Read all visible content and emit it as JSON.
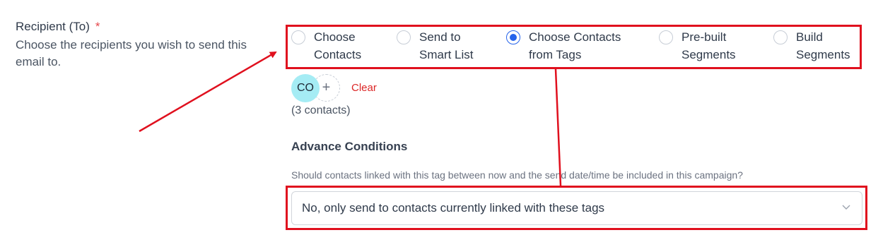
{
  "recipient": {
    "label": "Recipient (To)",
    "required_mark": "*",
    "help_text": "Choose the recipients you wish to send this email to."
  },
  "radio_options": [
    {
      "line1": "Choose",
      "line2": "Contacts",
      "selected": false
    },
    {
      "line1": "Send to",
      "line2": "Smart List",
      "selected": false
    },
    {
      "line1": "Choose Contacts",
      "line2": "from Tags",
      "selected": true
    },
    {
      "line1": "Pre-built",
      "line2": "Segments",
      "selected": false
    },
    {
      "line1": "Build",
      "line2": "Segments",
      "selected": false
    }
  ],
  "tags": {
    "chip_label": "CO",
    "add_icon": "+",
    "clear_label": "Clear",
    "contact_count": "(3 contacts)"
  },
  "advance": {
    "title": "Advance Conditions",
    "question": "Should contacts linked with this tag between now and the send date/time be included in this campaign?",
    "selected_value": "No, only send to contacts currently linked with these tags"
  },
  "colors": {
    "annotation": "#e0101e",
    "accent": "#2563eb",
    "chip": "#a5ecf4",
    "clear": "#dc2626"
  }
}
